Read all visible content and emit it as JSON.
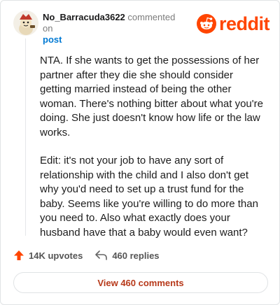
{
  "comment": {
    "username": "No_Barracuda3622",
    "commented_on": "commented on",
    "post_link": "post",
    "paragraphs": [
      "NTA. If she wants to get the possessions of her partner after they die she should consider getting married instead of being the other woman. There's nothing bitter about what you're doing. She just doesn't know how life or the law works.",
      "Edit: it's not your job to have any sort of relationship with the child and I also don't get why you'd need to set up a trust fund for the baby. Seems like you're willing to do more than you need to. Also what exactly does your husband have that a baby would even want?"
    ]
  },
  "brand": {
    "wordmark": "reddit",
    "color": "#ff4500"
  },
  "actions": {
    "upvotes": "14K upvotes",
    "replies": "460 replies"
  },
  "footer": {
    "view_comments": "View 460 comments"
  },
  "icons": [
    "avatar",
    "reddit-logo-icon",
    "upvote-icon",
    "reply-icon"
  ]
}
